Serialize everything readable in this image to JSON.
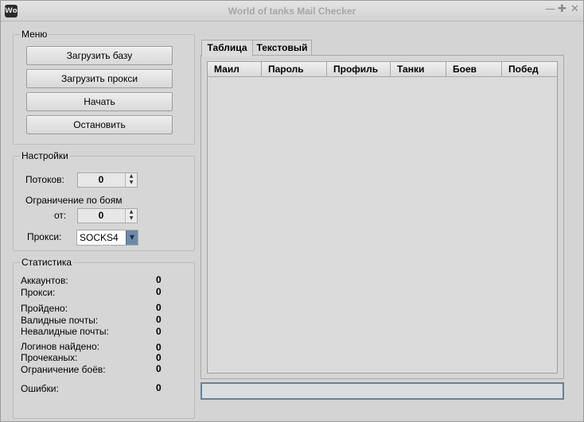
{
  "window": {
    "title": "World of tanks Mail Checker",
    "icon_text": "WoT",
    "controls": {
      "minimize": "—",
      "maximize": "✚",
      "close": "✕"
    }
  },
  "menu": {
    "legend": "Меню",
    "buttons": [
      "Загрузить базу",
      "Загрузить прокси",
      "Начать",
      "Остановить"
    ]
  },
  "settings": {
    "legend": "Настройки",
    "threads_label": "Потоков:",
    "threads_value": "0",
    "battle_limit_label": "Ограничение по боям",
    "from_label": "от:",
    "from_value": "0",
    "proxy_label": "Прокси:",
    "proxy_value": "SOCKS4"
  },
  "stats": {
    "legend": "Статистика",
    "rows": [
      {
        "label": "Аккаунтов:",
        "value": "0"
      },
      {
        "label": "Прокси:",
        "value": "0"
      },
      {
        "label": "Пройдено:",
        "value": "0"
      },
      {
        "label": "Валидные почты:",
        "value": "0"
      },
      {
        "label": "Невалидные почты:",
        "value": "0"
      },
      {
        "label": "Логинов найдено:",
        "value": "0"
      },
      {
        "label": "Прочеканых:",
        "value": "0"
      },
      {
        "label": "Ограничение боёв:",
        "value": "0"
      },
      {
        "label": "Ошибки:",
        "value": "0"
      }
    ]
  },
  "tabs": [
    "Таблица",
    "Текстовый"
  ],
  "table": {
    "columns": [
      "Маил",
      "Пароль",
      "Профиль",
      "Танки",
      "Боев",
      "Побед"
    ]
  },
  "status_bar": {
    "text": ""
  }
}
